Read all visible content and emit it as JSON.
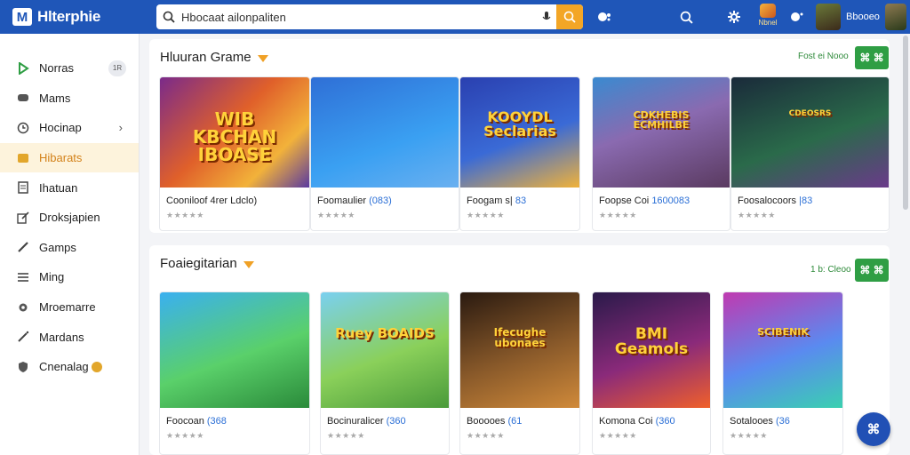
{
  "app": {
    "name": "Hlterphie",
    "logo_letter": "M"
  },
  "search": {
    "value": "Hbocaat ailonpaliten"
  },
  "header": {
    "badge_label": "Nbnel",
    "profile_name": "Bbooeo"
  },
  "sidebar": {
    "items": [
      {
        "label": "Norras",
        "icon": "play-icon",
        "count": "1R"
      },
      {
        "label": "Mams",
        "icon": "gamepad-icon"
      },
      {
        "label": "Hocinap",
        "icon": "clock-icon",
        "chevron": true
      },
      {
        "label": "Hibarats",
        "icon": "ticket-icon",
        "active": true
      },
      {
        "label": "Ihatuan",
        "icon": "list-icon"
      },
      {
        "label": "Droksjapien",
        "icon": "edit-icon"
      },
      {
        "label": "Gamps",
        "icon": "pen-icon"
      },
      {
        "label": "Ming",
        "icon": "menu-icon"
      },
      {
        "label": "Mroemarre",
        "icon": "gear-icon"
      },
      {
        "label": "Mardans",
        "icon": "wand-icon"
      },
      {
        "label": "Cnenalag",
        "icon": "shield-icon",
        "coin": true
      }
    ]
  },
  "section1": {
    "title": "Hluuran Grame",
    "more": "Fost ei Nooo",
    "button": "⌘ ⌘",
    "cards": [
      {
        "title": "Cooniloof 4rer Ldclo)",
        "tag": "",
        "stars": "★★★★★",
        "art": "WIB KBCHAN IBOASE"
      },
      {
        "title": "Foomaulier ",
        "tag": "(083)",
        "stars": "★★★★★",
        "art": ""
      },
      {
        "title": "Foogam s| ",
        "tag": "83",
        "stars": "★★★★★",
        "art": "KOOYDL Seclarias"
      },
      {
        "title": "Foopse Coi ",
        "tag": "1600083",
        "stars": "★★★★★",
        "art": "CDKHEBIS ECMHILBE"
      },
      {
        "title": "Foosalocoors ",
        "tag": "|83",
        "stars": "★★★★★",
        "art": "CDEOSRS"
      }
    ]
  },
  "section2": {
    "title": "Foaiegitarian",
    "more": "1 b: Cleoo",
    "button": "⌘ ⌘",
    "cards": [
      {
        "title": "Foocoan ",
        "tag": "(368",
        "stars": "★★★★★",
        "art": ""
      },
      {
        "title": "Bocinuralicer ",
        "tag": "(360",
        "stars": "★★★★★",
        "art": "Ruey BOAIDS"
      },
      {
        "title": "Booooes ",
        "tag": "(61",
        "stars": "★★★★★",
        "art": "Ifecughe ubonaes"
      },
      {
        "title": "Komona Coi ",
        "tag": "(360",
        "stars": "★★★★★",
        "art": "BMI Geamols"
      },
      {
        "title": "Sotalooes ",
        "tag": "(36",
        "stars": "★★★★★",
        "art": "SCIBENIK"
      }
    ]
  },
  "fab": {
    "label": "⌘"
  },
  "colors": {
    "topbar": "#1f56b8",
    "accent": "#f3a626",
    "green": "#2f9e44",
    "active_bg": "#fdf3dc"
  }
}
